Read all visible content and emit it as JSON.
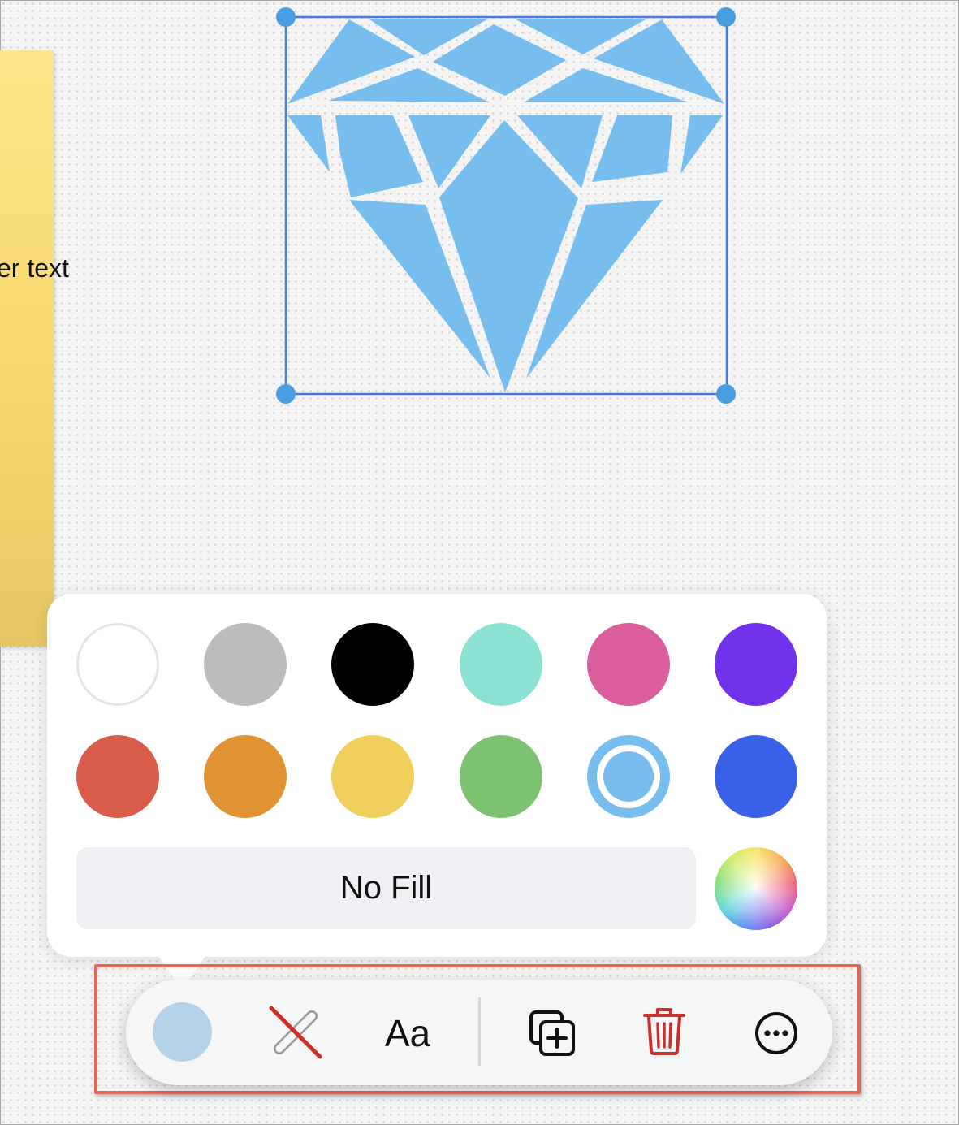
{
  "canvas": {
    "sticky_note_text": "er text",
    "selected_shape": "diamond",
    "shape_fill_color": "#77bdee"
  },
  "color_popover": {
    "swatches": [
      {
        "name": "white",
        "color": "#ffffff"
      },
      {
        "name": "gray",
        "color": "#bcbcbc"
      },
      {
        "name": "black",
        "color": "#000000"
      },
      {
        "name": "mint",
        "color": "#8de1d3"
      },
      {
        "name": "pink",
        "color": "#da5e9c"
      },
      {
        "name": "purple",
        "color": "#7032ea"
      },
      {
        "name": "red",
        "color": "#d95b49"
      },
      {
        "name": "orange",
        "color": "#e19334"
      },
      {
        "name": "yellow",
        "color": "#f0cf5d"
      },
      {
        "name": "green",
        "color": "#7dc270"
      },
      {
        "name": "light-blue",
        "color": "#77bdee",
        "selected": true
      },
      {
        "name": "blue",
        "color": "#3961e8"
      }
    ],
    "no_fill_label": "No Fill",
    "custom_color_icon": "color-wheel-icon"
  },
  "toolbar": {
    "fill_color": "#b4d3e8",
    "stroke_icon": "no-stroke-icon",
    "text_style_label": "Aa",
    "duplicate_icon": "duplicate-icon",
    "delete_icon": "trash-icon",
    "more_icon": "ellipsis-circle-icon",
    "highlight_color": "#e0675a",
    "delete_color": "#c9302c"
  }
}
